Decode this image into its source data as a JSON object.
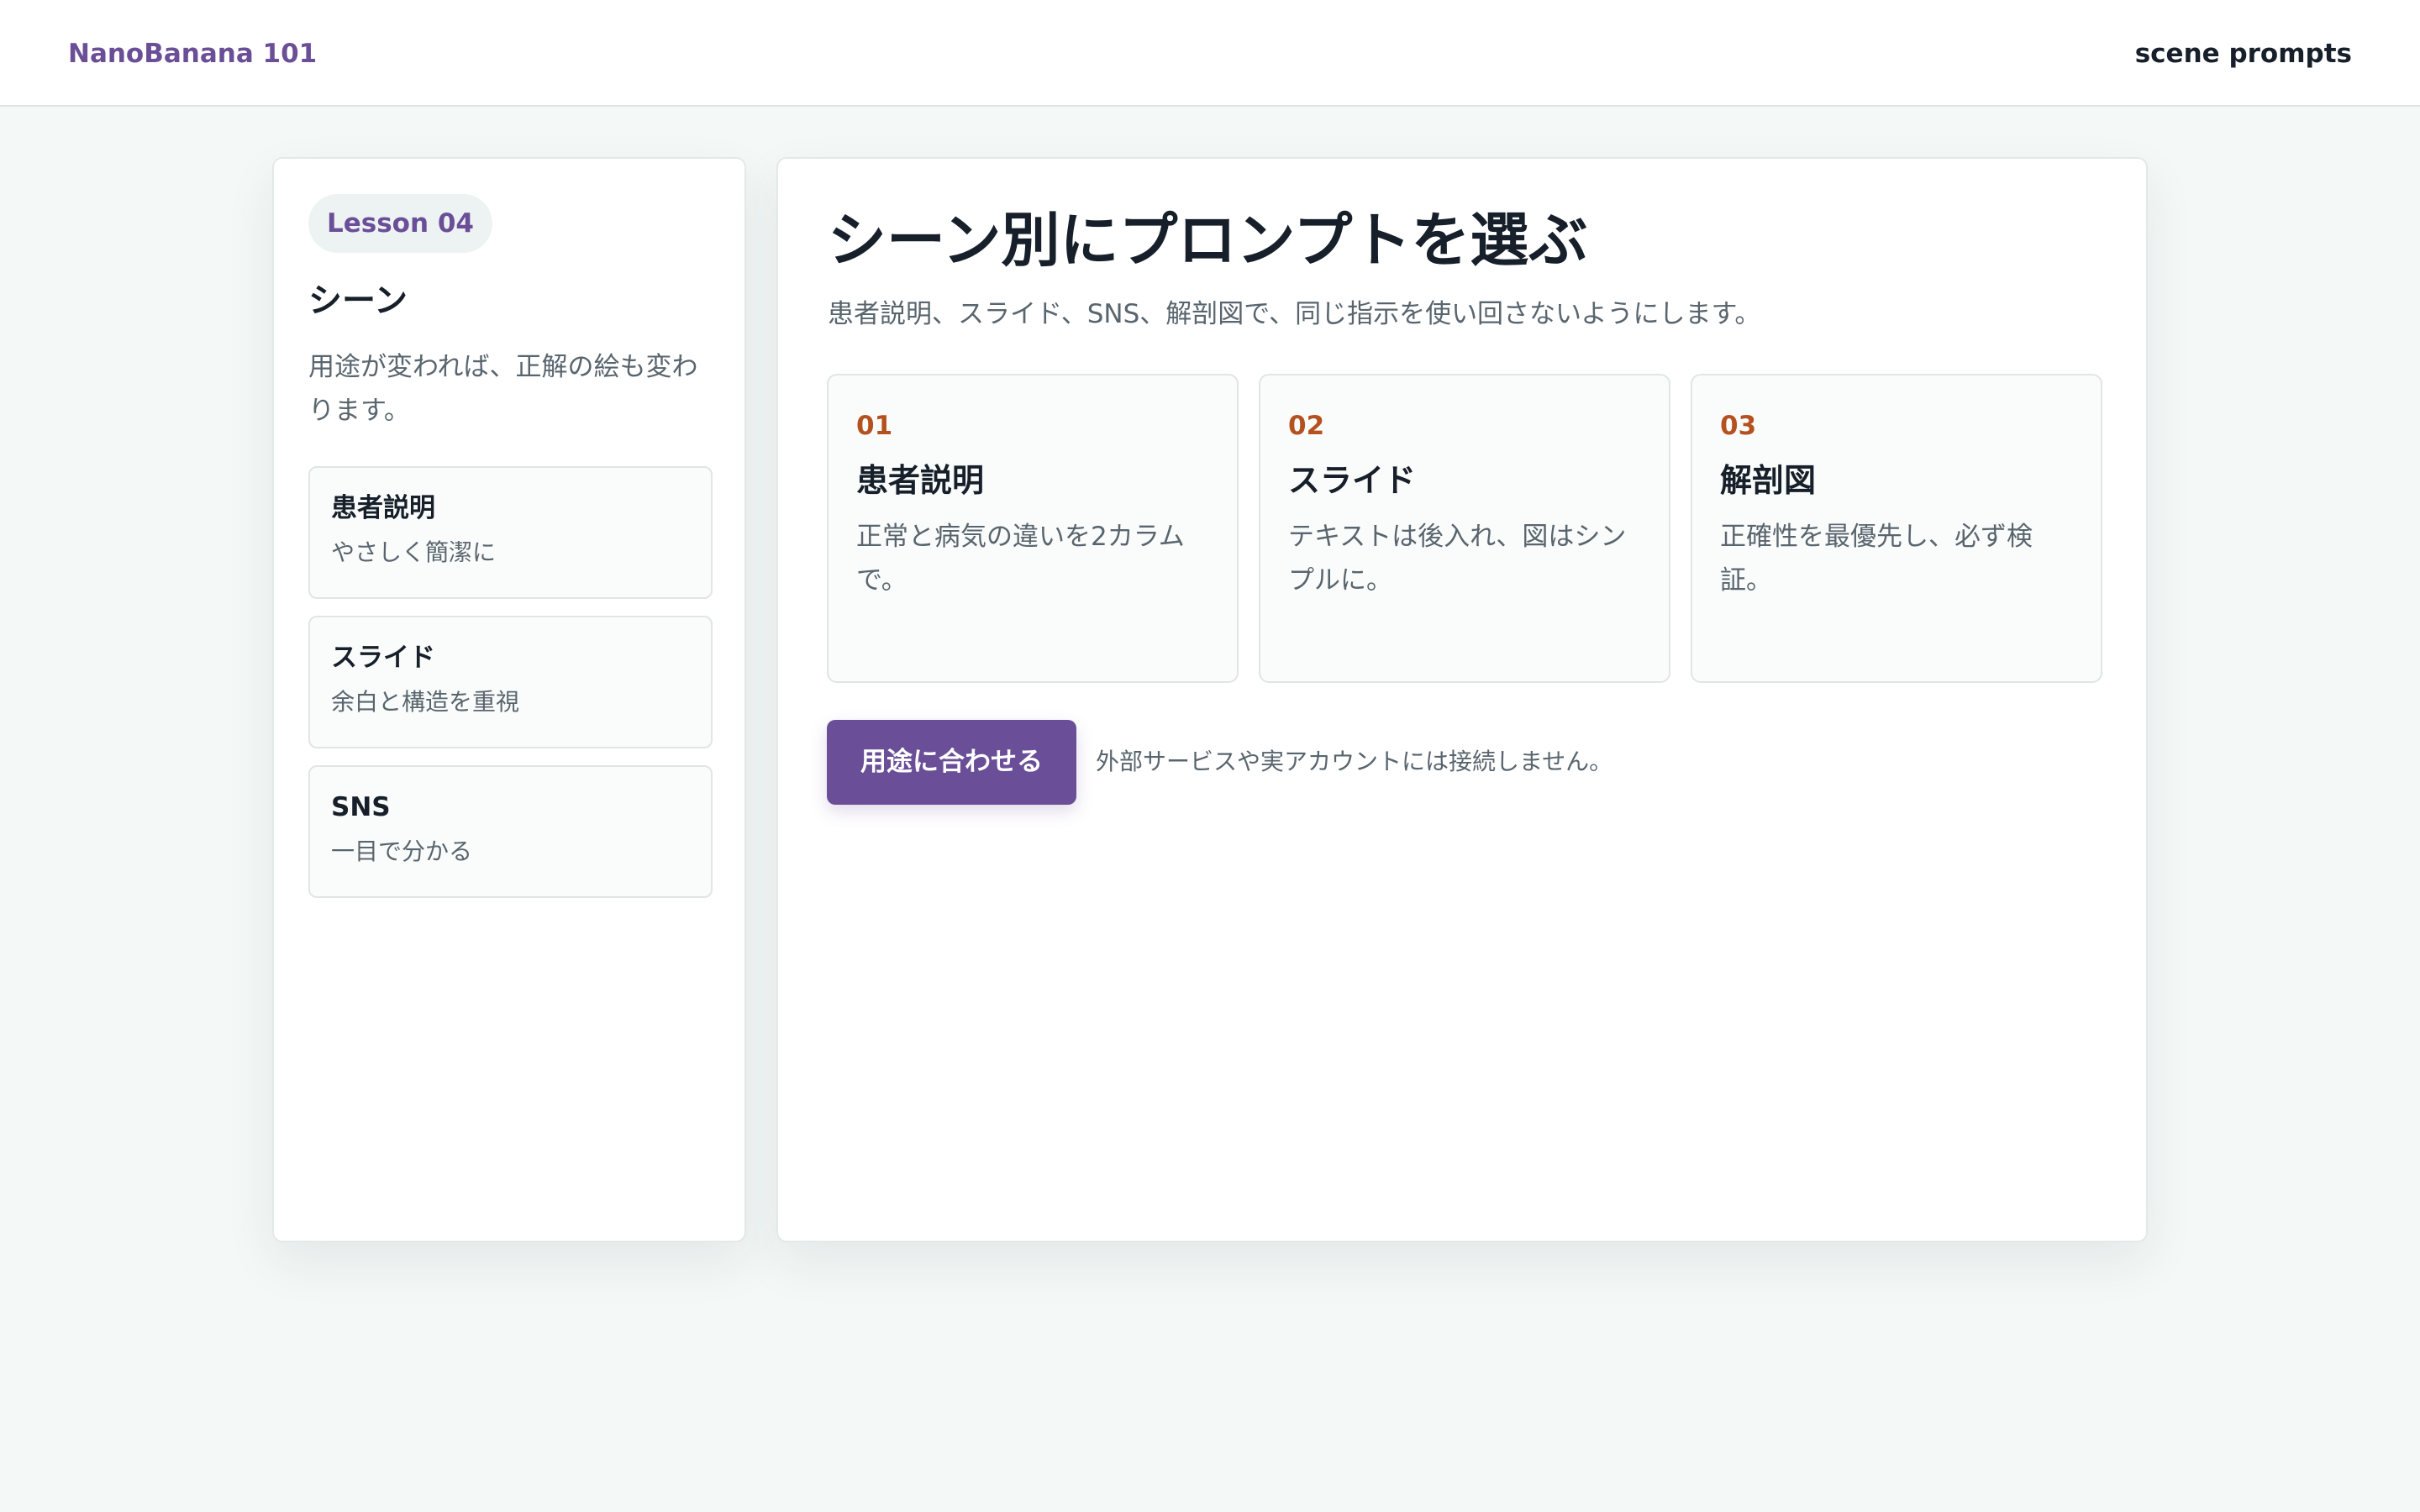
{
  "header": {
    "brand": "NanoBanana 101",
    "right_label": "scene prompts"
  },
  "sidebar": {
    "badge": "Lesson 04",
    "title": "シーン",
    "description": "用途が変われば、正解の絵も変わります。",
    "scenes": [
      {
        "title": "患者説明",
        "subtitle": "やさしく簡潔に"
      },
      {
        "title": "スライド",
        "subtitle": "余白と構造を重視"
      },
      {
        "title": "SNS",
        "subtitle": "一目で分かる"
      }
    ]
  },
  "main": {
    "title": "シーン別にプロンプトを選ぶ",
    "subtitle": "患者説明、スライド、SNS、解剖図で、同じ指示を使い回さないようにします。",
    "steps": [
      {
        "num": "01",
        "title": "患者説明",
        "desc": "正常と病気の違いを2カラムで。"
      },
      {
        "num": "02",
        "title": "スライド",
        "desc": "テキストは後入れ、図はシンプルに。"
      },
      {
        "num": "03",
        "title": "解剖図",
        "desc": "正確性を最優先し、必ず検証。"
      }
    ],
    "action_button": "用途に合わせる",
    "action_note": "外部サービスや実アカウントには接続しません。"
  },
  "colors": {
    "accent": "#6a4e97",
    "step_number": "#b5501f",
    "background": "#f4f8f7"
  }
}
